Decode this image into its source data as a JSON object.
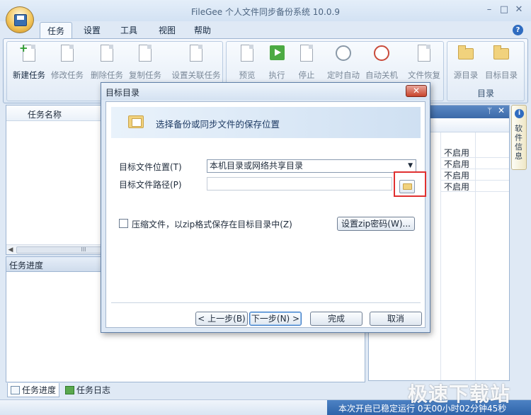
{
  "window": {
    "title": "FileGee 个人文件同步备份系统 10.0.9",
    "min": "–",
    "max": "□",
    "close": "✕"
  },
  "tabs": [
    {
      "label": "任务",
      "active": true
    },
    {
      "label": "设置"
    },
    {
      "label": "工具"
    },
    {
      "label": "视图"
    },
    {
      "label": "帮助"
    }
  ],
  "ribbon": {
    "new_task": "新建任务",
    "edit_task": "修改任务",
    "delete_task": "删除任务",
    "copy_task": "复制任务",
    "set_related": "设置关联任务",
    "preview": "预览",
    "run": "执行",
    "stop": "停止",
    "timed_auto": "定时自动",
    "auto_shutdown": "自动关机",
    "file_restore": "文件恢复",
    "source_dir": "源目录",
    "target_dir": "目标目录",
    "dir_group": "目录"
  },
  "task_list": {
    "col_name": "任务名称",
    "scroll_thumb": "III"
  },
  "right_panel": {
    "pin": "ᛘ",
    "close": "✕",
    "statuses": [
      "不启用",
      "不启用",
      "不启用",
      "不启用"
    ]
  },
  "side_tab": {
    "label": "软件信息",
    "icon": "i"
  },
  "progress": {
    "title": "任务进度"
  },
  "bottom_tabs": {
    "progress": "任务进度",
    "log": "任务日志"
  },
  "statusbar": {
    "text": "本次开启已稳定运行 0天00小时02分钟45秒"
  },
  "watermark": "极速下载站",
  "dialog": {
    "title": "目标目录",
    "close": "✕",
    "banner": "选择备份或同步文件的保存位置",
    "location_label": "目标文件位置(T)",
    "location_value": "本机目录或网络共享目录",
    "path_label": "目标文件路径(P)",
    "path_value": "",
    "compress_label": "压缩文件，以zip格式保存在目标目录中(Z)",
    "zip_password": "设置zip密码(W)...",
    "prev": "< 上一步(B)",
    "next": "下一步(N) >",
    "finish": "完成",
    "cancel": "取消"
  }
}
